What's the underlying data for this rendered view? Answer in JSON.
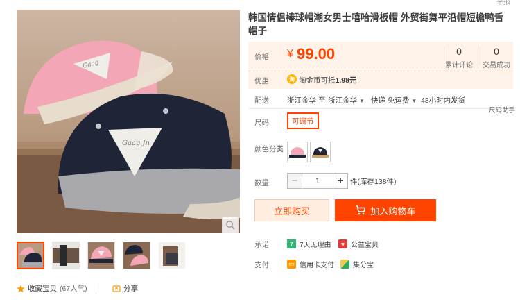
{
  "header": {
    "cut_text": "举报"
  },
  "product": {
    "title": "韩国情侣棒球帽潮女男士嘻哈滑板帽 外贸街舞平沿帽短檐鸭舌帽子"
  },
  "price": {
    "label": "价格",
    "currency": "¥",
    "value": "99.00",
    "reviews_count": "0",
    "reviews_label": "累计评论",
    "sales_count": "0",
    "sales_label": "交易成功"
  },
  "promo": {
    "label": "优惠",
    "coin_glyph": "淘",
    "text_prefix": "淘金币可抵",
    "amount": "1.98元"
  },
  "shipping": {
    "label": "配送",
    "from": "浙江金华",
    "to_word": "至",
    "to": "浙江金华",
    "method": "快递 免运费",
    "delivery": "48小时内发货"
  },
  "size": {
    "label": "尺码",
    "selected": "可调节",
    "help": "尺码助手"
  },
  "color": {
    "label": "颜色分类"
  },
  "quantity": {
    "label": "数量",
    "minus": "−",
    "value": "1",
    "plus": "+",
    "unit_stock": "件(库存138件)"
  },
  "actions": {
    "buy_now": "立即购买",
    "add_to_cart": "加入购物车"
  },
  "promise": {
    "label": "承诺",
    "item1_icon": "7",
    "item1": "7天无理由",
    "item2": "公益宝贝"
  },
  "payment": {
    "label": "支付",
    "item1": "信用卡支付",
    "item2": "集分宝"
  },
  "social": {
    "collect": "收藏宝贝",
    "collect_count": "(67人气)",
    "share": "分享"
  },
  "colors": {
    "accent": "#ff4400",
    "price": "#ff4400",
    "price_bg": "#fff2e8",
    "pink_cap": "#f3a7b6",
    "navy_cap": "#1f2536"
  },
  "icons": {
    "zoom": "search-icon",
    "collect": "star-icon",
    "share": "share-icon",
    "cart": "cart-icon"
  }
}
